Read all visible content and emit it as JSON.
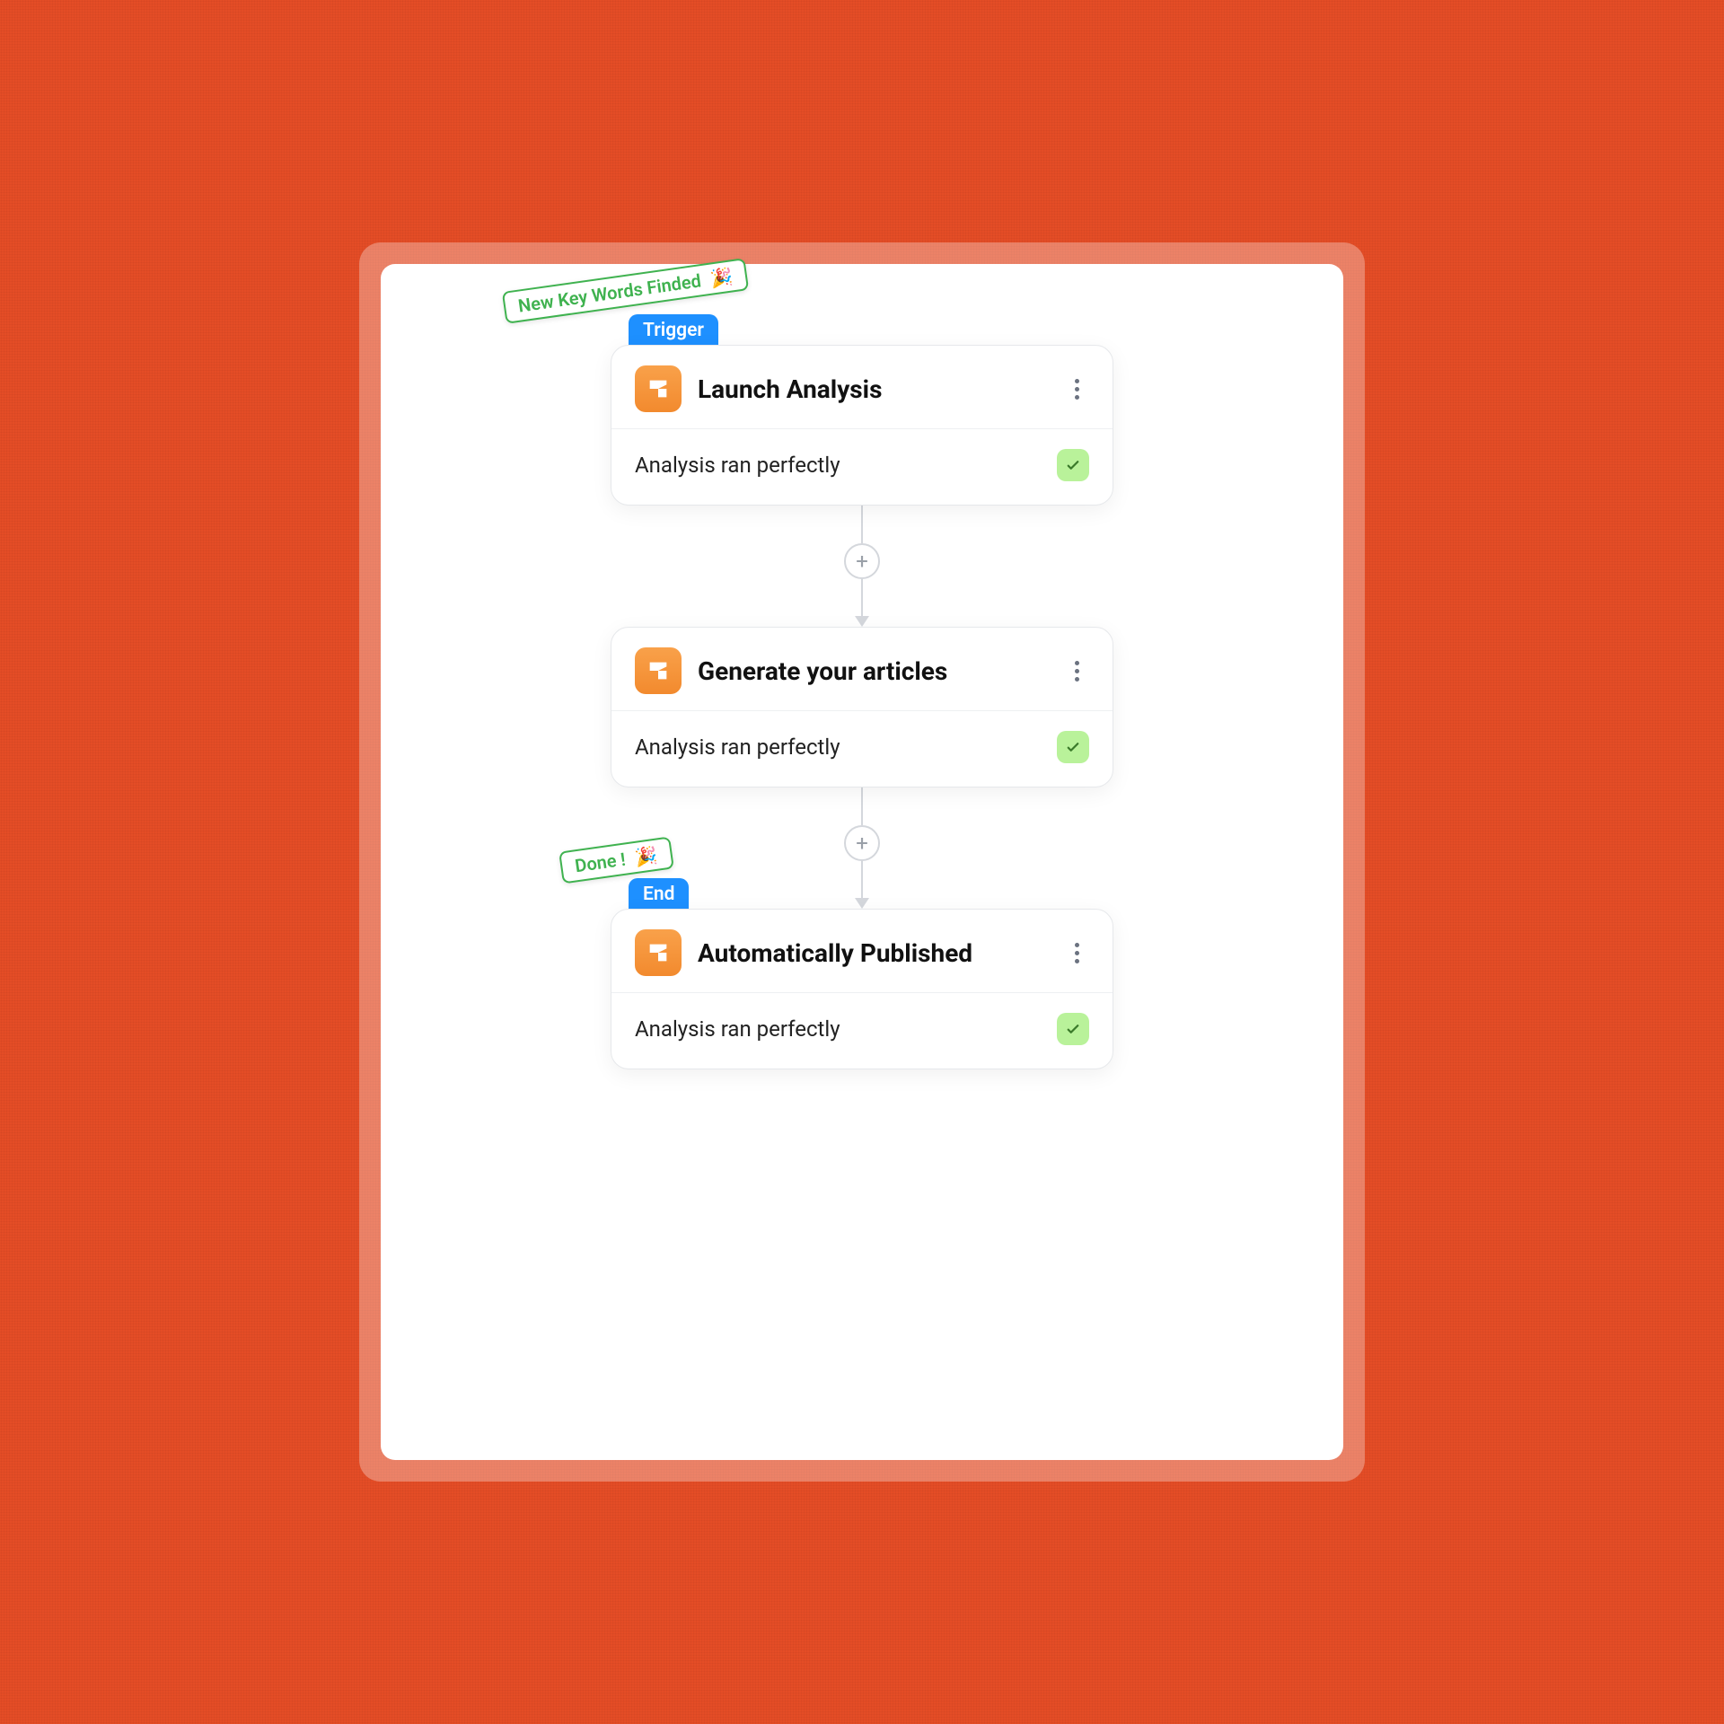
{
  "badges": {
    "top": {
      "text": "New Key Words Finded",
      "emoji": "🎉"
    },
    "bottom": {
      "text": "Done !",
      "emoji": "🎉"
    }
  },
  "nodes": [
    {
      "pill": "Trigger",
      "title": "Launch Analysis",
      "status": "Analysis ran perfectly"
    },
    {
      "pill": null,
      "title": "Generate your articles",
      "status": "Analysis ran perfectly"
    },
    {
      "pill": "End",
      "title": "Automatically Published",
      "status": "Analysis ran perfectly"
    }
  ],
  "colors": {
    "bg": "#e44d26",
    "pill": "#1e90ff",
    "stickerBorder": "#3fb24f",
    "iconBg": "#f28a2e",
    "check": "#b9f29a"
  }
}
